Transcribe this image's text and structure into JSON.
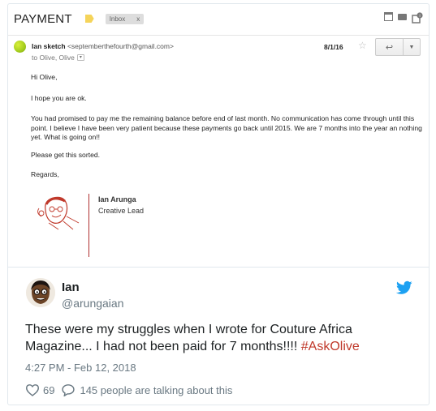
{
  "email": {
    "subject": "PAYMENT",
    "inbox_label": "Inbox",
    "inbox_close": "x",
    "sender_name": "Ian sketch",
    "sender_address": "<septemberthefourth@gmail.com>",
    "to_line": "to Olive, Olive",
    "date": "8/1/16",
    "greeting": "Hi Olive,",
    "line1": "I hope you are ok.",
    "paragraph": "You had promised to pay me the remaining balance before end of last month. No communication has come through until this point. I believe I have been very patient because these payments go back until 2015. We are 7 months into the year an nothing yet. What is going on!!",
    "line_sort": "Please get this sorted.",
    "regards": "Regards,",
    "signature_name": "Ian Arunga",
    "signature_role": "Creative Lead"
  },
  "tweet": {
    "name": "Ian",
    "handle": "@arungaian",
    "text": "These were my struggles when I wrote for Couture Africa Magazine... I had not been paid for 7 months!!!! ",
    "hashtag": "#AskOlive",
    "timestamp": "4:27 PM - Feb 12, 2018",
    "likes": "69",
    "talking": "145 people are talking about this"
  },
  "colors": {
    "twitter_blue": "#1da1f2",
    "hashtag": "#c0392b",
    "label_yellow": "#f5d45a",
    "signature_red": "#b03030"
  },
  "icons": [
    "label-icon",
    "archive-icon",
    "print-icon",
    "new-window-icon",
    "sender-avatar-icon",
    "star-icon",
    "reply-icon",
    "more-icon",
    "twitter-bird-icon",
    "heart-icon",
    "comment-icon"
  ]
}
